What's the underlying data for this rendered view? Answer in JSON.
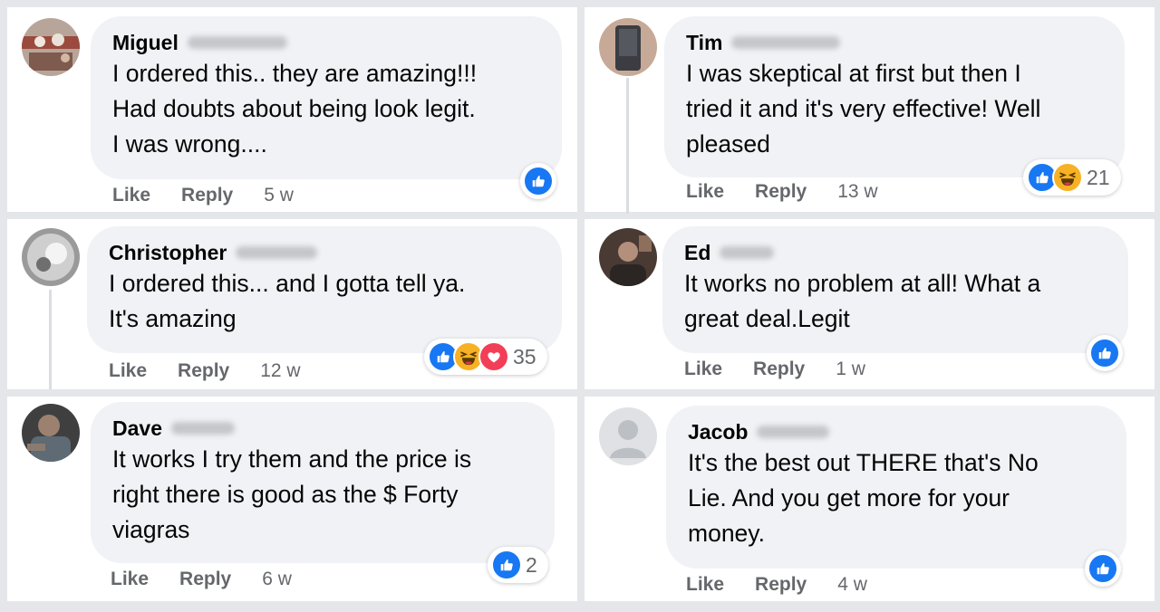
{
  "actions": {
    "like": "Like",
    "reply": "Reply"
  },
  "colors": {
    "like_blue": "#1877f2",
    "haha_yellow": "#f7b125",
    "love_red": "#f33e58",
    "bubble": "#f0f2f5",
    "meta_gray": "#65676b"
  },
  "comments": [
    {
      "author": "Miguel",
      "text": [
        "I ordered this.. they are amazing!!!",
        "Had doubts about being look legit.",
        "I was wrong...."
      ],
      "time": "5 w",
      "reactions": [
        "like-icon"
      ],
      "reaction_count": ""
    },
    {
      "author": "Tim",
      "text": [
        "I was skeptical at first but then I",
        "tried it and it's very effective! Well",
        "pleased"
      ],
      "time": "13 w",
      "reactions": [
        "like-icon",
        "haha-icon"
      ],
      "reaction_count": "21"
    },
    {
      "author": "Christopher",
      "text": [
        "I ordered this... and I gotta tell ya.",
        "It's amazing"
      ],
      "time": "12 w",
      "reactions": [
        "like-icon",
        "haha-icon",
        "love-icon"
      ],
      "reaction_count": "35"
    },
    {
      "author": "Ed",
      "text": [
        "It works no problem at all! What a",
        "great deal.Legit"
      ],
      "time": "1 w",
      "reactions": [
        "like-icon"
      ],
      "reaction_count": ""
    },
    {
      "author": "Dave",
      "text": [
        "It works I try them and the price is",
        "right there is good as the $ Forty",
        "viagras"
      ],
      "time": "6 w",
      "reactions": [
        "like-icon"
      ],
      "reaction_count": "2"
    },
    {
      "author": "Jacob",
      "text": [
        "It's the best out THERE that's No",
        "Lie. And you get more for your",
        "money."
      ],
      "time": "4 w",
      "reactions": [
        "like-icon"
      ],
      "reaction_count": ""
    }
  ]
}
